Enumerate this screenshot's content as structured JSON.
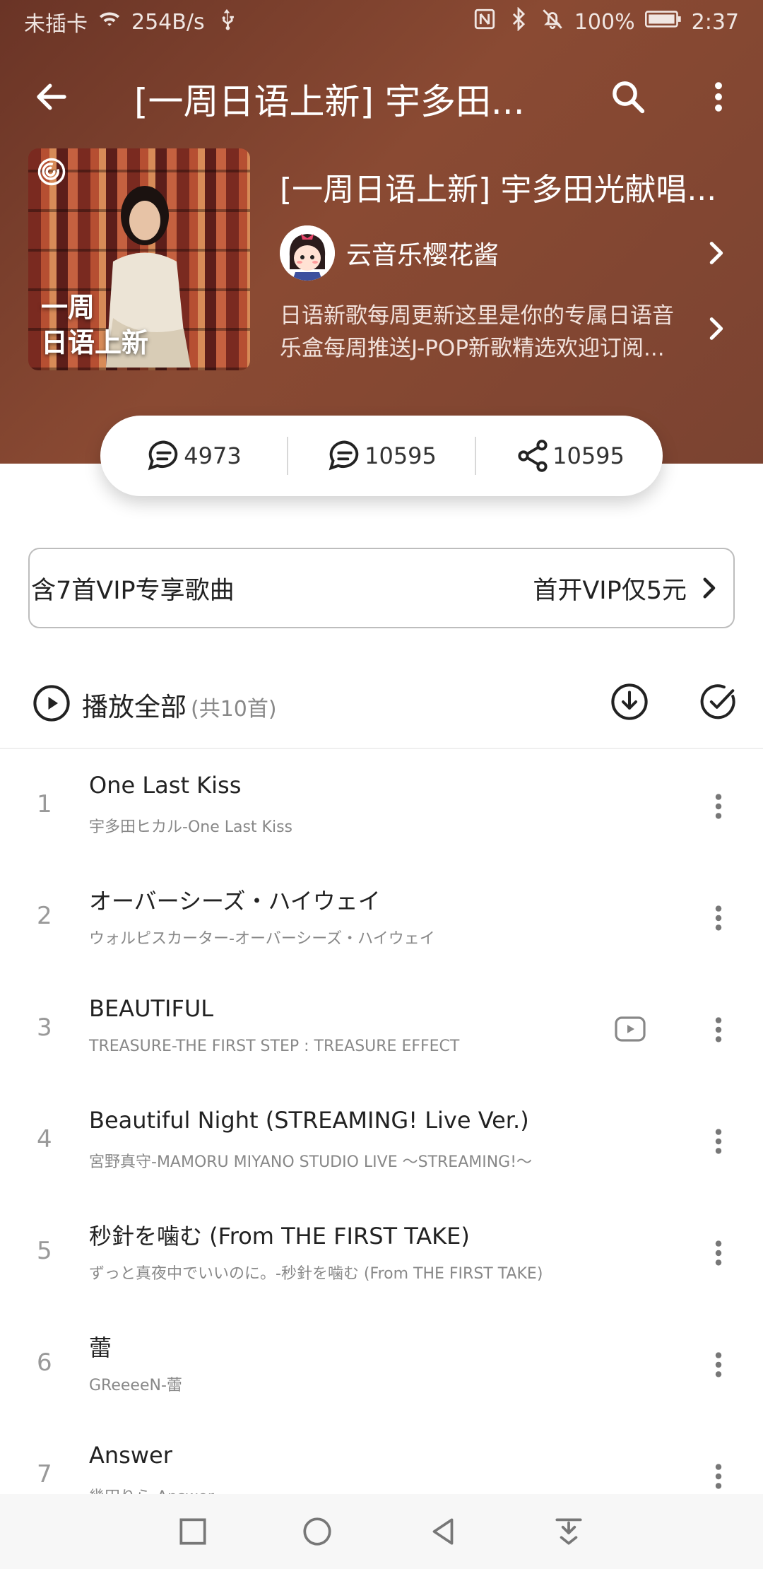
{
  "status_bar": {
    "carrier": "未插卡",
    "speed": "254B/s",
    "battery": "100%",
    "time": "2:37"
  },
  "header": {
    "title": "[一周日语上新] 宇多田..."
  },
  "playlist": {
    "cover_text_line1": "一周",
    "cover_text_line2": "日语上新",
    "title": "[一周日语上新] 宇多田光献唱...",
    "creator": "云音乐樱花酱",
    "description": "日语新歌每周更新这里是你的专属日语音乐盒每周推送J-POP新歌精选欢迎订阅..."
  },
  "stats": {
    "favorites": "4973",
    "comments": "10595",
    "shares": "10595"
  },
  "vip_banner": {
    "left_text": "含7首VIP专享歌曲",
    "right_text": "首开VIP仅5元"
  },
  "play_all": {
    "label": "播放全部",
    "count": "(共10首)"
  },
  "songs": [
    {
      "num": "1",
      "title": "One Last Kiss",
      "artist": "宇多田ヒカル-One Last Kiss"
    },
    {
      "num": "2",
      "title": "オーバーシーズ・ハイウェイ",
      "artist": "ウォルピスカーター-オーバーシーズ・ハイウェイ"
    },
    {
      "num": "3",
      "title": "BEAUTIFUL",
      "artist": "TREASURE-THE FIRST STEP : TREASURE EFFECT"
    },
    {
      "num": "4",
      "title": "Beautiful Night (STREAMING! Live Ver.)",
      "artist": "宮野真守-MAMORU MIYANO STUDIO LIVE ～STREAMING!～"
    },
    {
      "num": "5",
      "title": "秒針を噛む (From THE FIRST TAKE)",
      "artist": "ずっと真夜中でいいのに。-秒針を噛む (From THE FIRST TAKE)"
    },
    {
      "num": "6",
      "title": "蕾",
      "artist": "GReeeeN-蕾"
    },
    {
      "num": "7",
      "title": "Answer",
      "artist": "幾田りら-Answer"
    }
  ],
  "colors": {
    "header_bg": "#7b4331",
    "accent": "#222222"
  }
}
